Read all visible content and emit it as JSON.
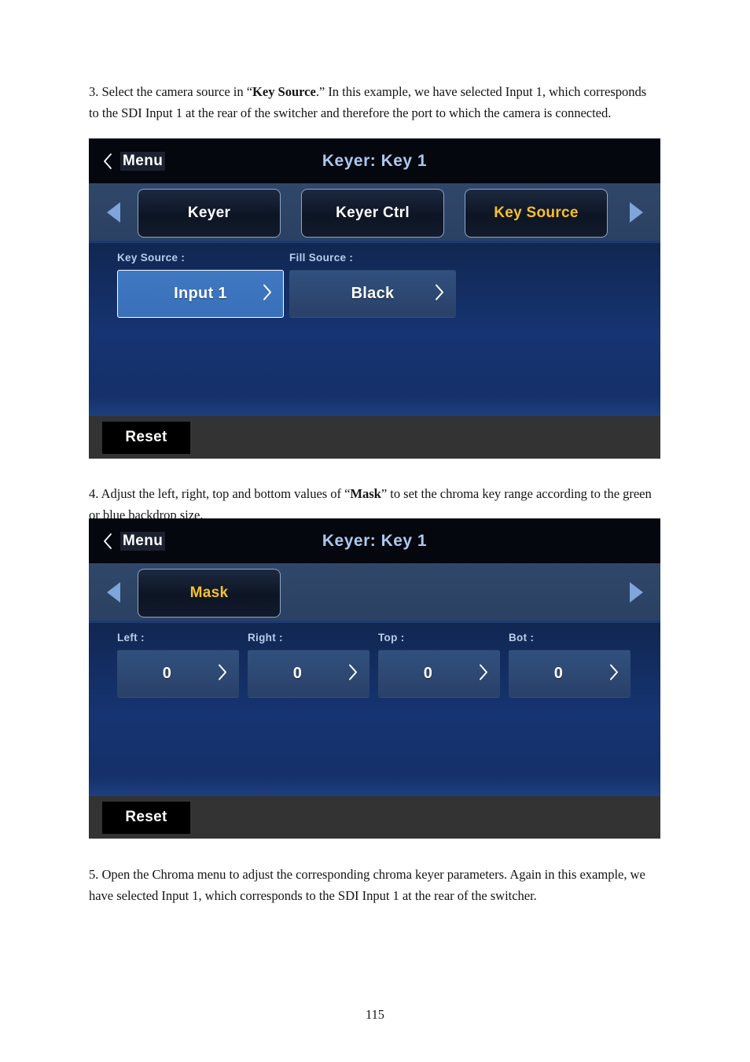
{
  "document": {
    "page_number": "115",
    "paragraphs": {
      "step3": {
        "prefix": "3. Select the camera source in “",
        "bold": "Key Source",
        "suffix": ".” In this example, we have selected Input 1, which corresponds to the SDI Input 1 at the rear of the switcher and therefore the port to which the camera is connected."
      },
      "step4": {
        "prefix": "4. Adjust the left, right, top and bottom values of “",
        "bold": "Mask",
        "suffix": "” to set the chroma key range according to the green or blue backdrop size."
      },
      "step5": {
        "prefix": "5. Open the Chroma menu to adjust the corresponding chroma keyer parameters. Again in this example, we have selected Input 1, which corresponds to the SDI Input 1 at the rear of the switcher.",
        "bold": "",
        "suffix": ""
      }
    }
  },
  "colors": {
    "accent_gold": "#f7c02c",
    "title_blue": "#aac9ee",
    "selected_blue": "#3a70ba",
    "panel_navy": "#163472",
    "tabbar_slate": "#2f4769",
    "reset_bar_gray": "#333333",
    "arrow_blue": "#7fa5da",
    "label_blue": "#b9cdeb"
  },
  "screenshot_keysource": {
    "titlebar": {
      "back_icon": "chevron-left-icon",
      "back_label": "Menu",
      "title": "Keyer: Key 1"
    },
    "nav": {
      "prev_icon": "triangle-left-icon",
      "next_icon": "triangle-right-icon"
    },
    "tabs": [
      {
        "label": "Keyer",
        "active": false
      },
      {
        "label": "Keyer Ctrl",
        "active": false
      },
      {
        "label": "Key Source",
        "active": true
      }
    ],
    "fields": [
      {
        "label": "Key Source :",
        "value": "Input 1",
        "selected": true,
        "chevron_icon": "chevron-right-icon"
      },
      {
        "label": "Fill Source :",
        "value": "Black",
        "selected": false,
        "chevron_icon": "chevron-right-icon"
      }
    ],
    "reset_label": "Reset"
  },
  "screenshot_mask": {
    "titlebar": {
      "back_icon": "chevron-left-icon",
      "back_label": "Menu",
      "title": "Keyer: Key 1"
    },
    "nav": {
      "prev_icon": "triangle-left-icon",
      "next_icon": "triangle-right-icon"
    },
    "tabs": [
      {
        "label": "Mask",
        "active": true
      }
    ],
    "fields": [
      {
        "label": "Left :",
        "value": "0",
        "selected": false,
        "chevron_icon": "chevron-right-icon"
      },
      {
        "label": "Right :",
        "value": "0",
        "selected": false,
        "chevron_icon": "chevron-right-icon"
      },
      {
        "label": "Top :",
        "value": "0",
        "selected": false,
        "chevron_icon": "chevron-right-icon"
      },
      {
        "label": "Bot :",
        "value": "0",
        "selected": false,
        "chevron_icon": "chevron-right-icon"
      }
    ],
    "reset_label": "Reset"
  }
}
